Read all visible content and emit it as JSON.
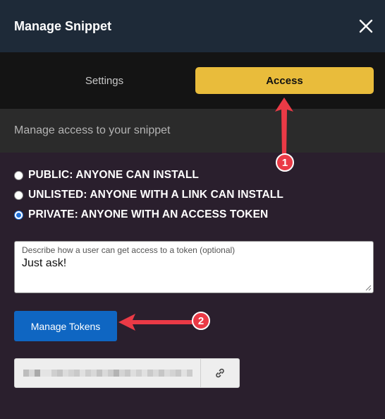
{
  "dialog": {
    "title": "Manage Snippet",
    "close_icon": "close-icon"
  },
  "tabs": [
    {
      "label": "Settings",
      "active": false
    },
    {
      "label": "Access",
      "active": true
    }
  ],
  "subheader": "Manage access to your snippet",
  "access_options": [
    {
      "label": "PUBLIC: ANYONE CAN INSTALL",
      "checked": false
    },
    {
      "label": "UNLISTED: ANYONE WITH A LINK CAN INSTALL",
      "checked": false
    },
    {
      "label": "PRIVATE: ANYONE WITH AN ACCESS TOKEN",
      "checked": true
    }
  ],
  "token_description": {
    "label": "Describe how a user can get access to a token (optional)",
    "value": "Just ask!"
  },
  "manage_tokens_label": "Manage Tokens",
  "token_field": {
    "masked": true,
    "copy_icon": "link-icon"
  },
  "annotations": [
    {
      "number": "1"
    },
    {
      "number": "2"
    }
  ],
  "colors": {
    "accent_tab": "#e9bc3b",
    "primary_button": "#0f66c2",
    "annotation": "#ea3a46",
    "body_bg": "#2a1f2d",
    "header_bg": "#1e2a38"
  }
}
